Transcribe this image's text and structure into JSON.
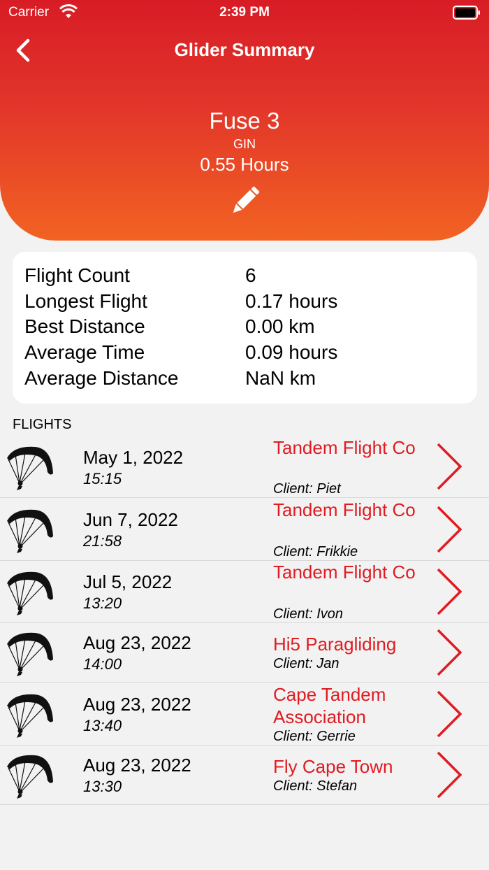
{
  "status_bar": {
    "carrier": "Carrier",
    "time": "2:39 PM"
  },
  "nav": {
    "title": "Glider Summary",
    "back_icon": "chevron-left-icon"
  },
  "glider": {
    "name": "Fuse 3",
    "brand": "GIN",
    "hours": "0.55 Hours",
    "edit_icon": "pencil-icon"
  },
  "stats": [
    {
      "label": "Flight Count",
      "value": "6"
    },
    {
      "label": "Longest Flight",
      "value": "0.17 hours"
    },
    {
      "label": "Best Distance",
      "value": "0.00 km"
    },
    {
      "label": "Average Time",
      "value": "0.09 hours"
    },
    {
      "label": "Average Distance",
      "value": "NaN km"
    }
  ],
  "flights_section": {
    "title": "FLIGHTS"
  },
  "flights": [
    {
      "date": "May 1, 2022",
      "time": "15:15",
      "company": "Tandem Flight Co",
      "client": "Client: Piet"
    },
    {
      "date": "Jun 7, 2022",
      "time": "21:58",
      "company": "Tandem Flight Co",
      "client": "Client: Frikkie"
    },
    {
      "date": "Jul 5, 2022",
      "time": "13:20",
      "company": "Tandem Flight Co",
      "client": "Client: Ivon"
    },
    {
      "date": "Aug 23, 2022",
      "time": "14:00",
      "company": "Hi5 Paragliding",
      "client": "Client: Jan"
    },
    {
      "date": "Aug 23, 2022",
      "time": "13:40",
      "company": "Cape Tandem Association",
      "client": "Client: Gerrie"
    },
    {
      "date": "Aug 23, 2022",
      "time": "13:30",
      "company": "Fly Cape Town",
      "client": "Client: Stefan"
    }
  ],
  "colors": {
    "accent": "#e01b22",
    "header_top": "#d81c26",
    "header_bottom": "#f26322"
  }
}
